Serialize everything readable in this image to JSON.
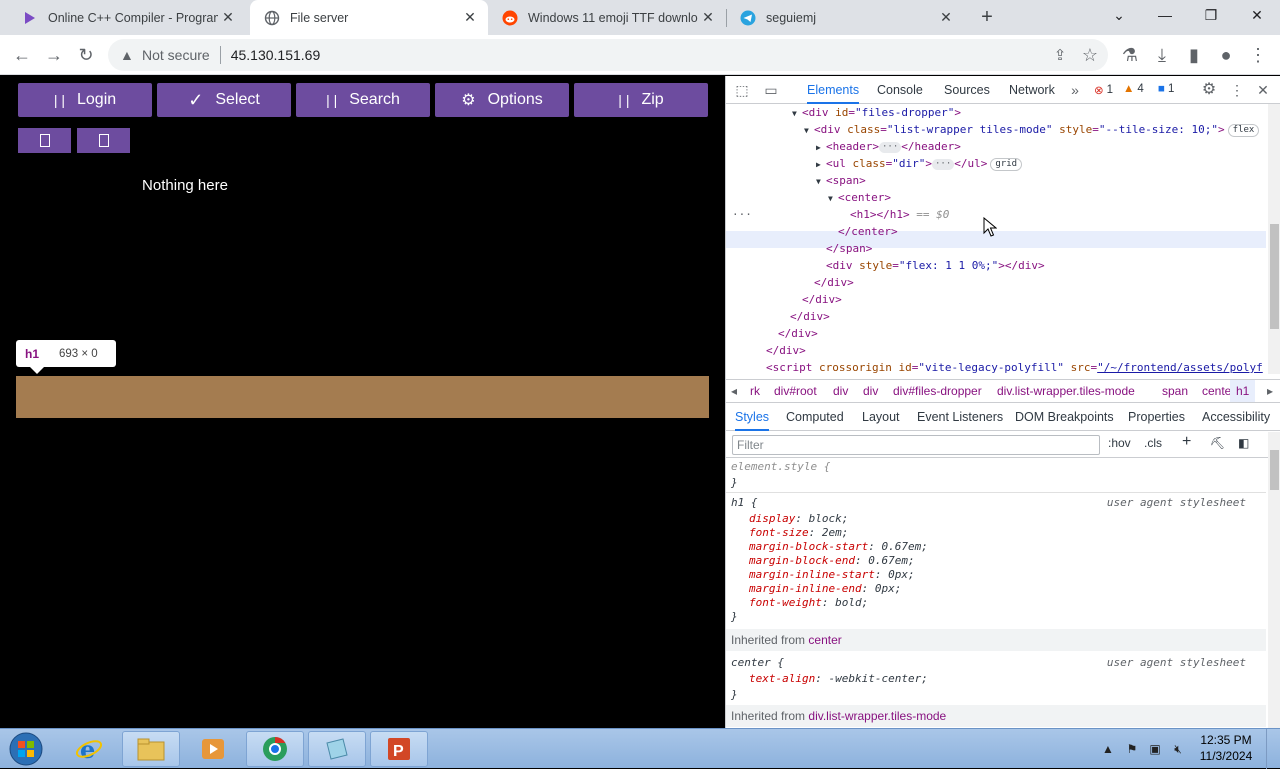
{
  "browser": {
    "tabs": [
      {
        "title": "Online C++ Compiler - Program",
        "favicon": "onlinegdb-icon",
        "active": false
      },
      {
        "title": "File server",
        "favicon": "globe-icon",
        "active": true
      },
      {
        "title": "Windows 11 emoji TTF downloa",
        "favicon": "reddit-icon",
        "active": false
      },
      {
        "title": "seguiemj",
        "favicon": "telegram-icon",
        "active": false
      }
    ],
    "address": {
      "security_label": "Not secure",
      "url": "45.130.151.69"
    }
  },
  "page": {
    "buttons": [
      {
        "label": "Login",
        "glyph": "| |"
      },
      {
        "label": "Select",
        "glyph": "✓"
      },
      {
        "label": "Search",
        "glyph": "| |"
      },
      {
        "label": "Options",
        "glyph": "⚙"
      },
      {
        "label": "Zip",
        "glyph": "| |"
      }
    ],
    "empty_text": "Nothing here",
    "tooltip": {
      "tag": "h1",
      "dims": "693 × 0"
    }
  },
  "devtools": {
    "tabs": [
      "Elements",
      "Console",
      "Sources",
      "Network"
    ],
    "issues": {
      "errors": "1",
      "warnings": "4",
      "info": "1"
    },
    "dom": {
      "l0": {
        "open": "<div",
        "attr": "id",
        "val": "\"files-dropper\"",
        "close": ">"
      },
      "l1": {
        "open": "<div",
        "attr1": "class",
        "val1": "\"list-wrapper tiles-mode\"",
        "attr2": "style",
        "val2": "\"--tile-size: 10;\"",
        "close": ">",
        "pill": "flex"
      },
      "l2": {
        "open": "<header>",
        "close": "</header>"
      },
      "l3": {
        "open": "<ul",
        "attr": "class",
        "val": "\"dir\"",
        "close": "</ul>",
        "pill": "grid"
      },
      "l4": "<span>",
      "l5": "<center>",
      "l6": {
        "tag": "<h1></h1>",
        "marker": "== $0"
      },
      "l7": "</center>",
      "l8": "</span>",
      "l9": {
        "open": "<div",
        "attr": "style",
        "val": "\"flex: 1 1 0%;\"",
        "close": "></div>"
      },
      "l10": "</div>",
      "l11": "</div>",
      "l12": "</div>",
      "l13": "</div>",
      "l14": "</div>",
      "l15": {
        "open": "<script",
        "attr1": "crossorigin",
        "attr2": "id",
        "val2": "\"vite-legacy-polyfill\"",
        "attr3": "src",
        "val3": "\"/~/frontend/assets/polyf"
      }
    },
    "breadcrumbs": [
      "rk",
      "div#root",
      "div",
      "div",
      "div#files-dropper",
      "div.list-wrapper.tiles-mode",
      "span",
      "center",
      "h1"
    ],
    "subtabs": [
      "Styles",
      "Computed",
      "Layout",
      "Event Listeners",
      "DOM Breakpoints",
      "Properties",
      "Accessibility"
    ],
    "filter_placeholder": "Filter",
    "filter_buttons": [
      ":hov",
      ".cls"
    ],
    "styles": {
      "element_style": "element.style {",
      "close": "}",
      "h1_selector": "h1 {",
      "h1_source": "user agent stylesheet",
      "h1_props": [
        {
          "name": "display",
          "value": "block;"
        },
        {
          "name": "font-size",
          "value": "2em;"
        },
        {
          "name": "margin-block-start",
          "value": "0.67em;"
        },
        {
          "name": "margin-block-end",
          "value": "0.67em;"
        },
        {
          "name": "margin-inline-start",
          "value": "0px;"
        },
        {
          "name": "margin-inline-end",
          "value": "0px;"
        },
        {
          "name": "font-weight",
          "value": "bold;"
        }
      ],
      "inherited1_label": "Inherited from",
      "inherited1_link": "center",
      "center_selector": "center {",
      "center_source": "user agent stylesheet",
      "center_prop": {
        "name": "text-align",
        "value": "-webkit-center;"
      },
      "inherited2_label": "Inherited from",
      "inherited2_link": "div.list-wrapper.tiles-mode"
    }
  },
  "taskbar": {
    "time": "12:35 PM",
    "date": "11/3/2024"
  },
  "colors": {
    "button_purple": "#6d4c9f",
    "highlight_tan": "#a47c50",
    "devtools_blue": "#1a73e8"
  }
}
